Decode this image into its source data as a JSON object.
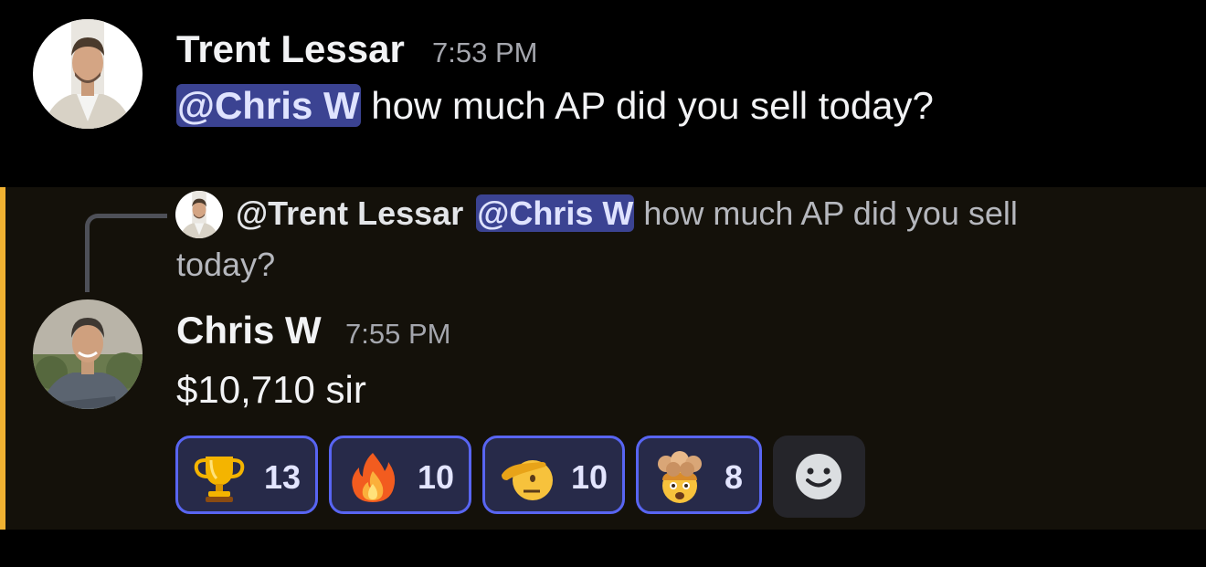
{
  "message1": {
    "author": "Trent Lessar",
    "time": "7:53 PM",
    "mention": "@Chris W",
    "text": " how much AP did you sell today?",
    "avatar_icon": "user-avatar"
  },
  "message2": {
    "reply": {
      "author": "@Trent Lessar",
      "mention": "@Chris W",
      "text_line1": " how much AP did you sell",
      "text_line2": "today?"
    },
    "author": "Chris W",
    "time": "7:55 PM",
    "text": "$10,710 sir",
    "reactions": [
      {
        "emoji": "trophy-emoji",
        "count": "13"
      },
      {
        "emoji": "fire-emoji",
        "count": "10"
      },
      {
        "emoji": "saluting-face-emoji",
        "count": "10"
      },
      {
        "emoji": "exploding-head-emoji",
        "count": "8"
      }
    ],
    "add_reaction_icon": "add-reaction-icon"
  },
  "colors": {
    "background": "#000000",
    "highlight_background": "#14110a",
    "mention_bar": "#f0b232",
    "mention_pill": "#3b4392",
    "reaction_border": "#5865f2"
  }
}
